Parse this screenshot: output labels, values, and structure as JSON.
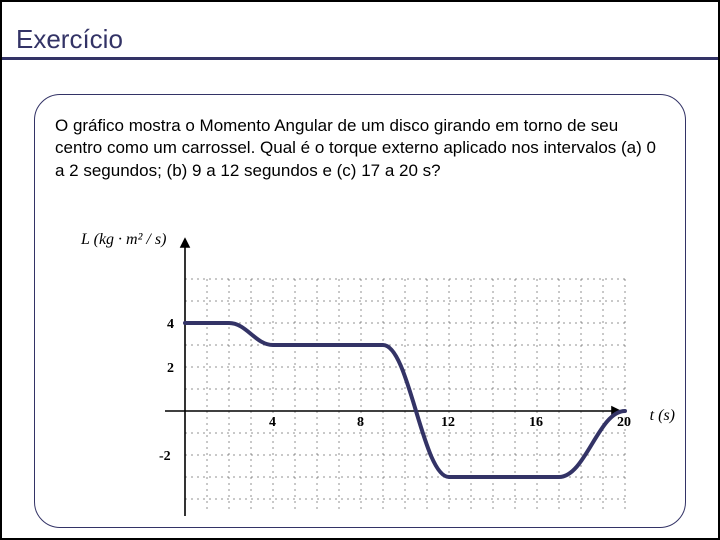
{
  "title": "Exercício",
  "prompt": "O gráfico mostra o Momento Angular de  um disco girando em torno de seu centro como um carrossel. Qual é o torque externo aplicado nos intervalos (a) 0 a 2 segundos; (b) 9 a 12 segundos e (c) 17 a 20 s?",
  "axes": {
    "y_label_html": "L (kg · m² / s)",
    "x_label": "t (s)",
    "x_ticks": [
      "4",
      "8",
      "12",
      "16",
      "20"
    ],
    "y_ticks": [
      "4",
      "2",
      "-2"
    ]
  },
  "chart_data": {
    "type": "line",
    "title": "",
    "xlabel": "t (s)",
    "ylabel": "L (kg·m^2/s)",
    "xlim": [
      0,
      22
    ],
    "ylim": [
      -4,
      6
    ],
    "series": [
      {
        "name": "L(t)",
        "x": [
          0,
          2,
          4,
          6,
          9,
          12,
          15,
          17,
          20
        ],
        "y": [
          4,
          4,
          3,
          3,
          3,
          -3,
          -3,
          -3,
          0
        ]
      }
    ]
  },
  "colors": {
    "frame": "#333366",
    "line": "#333366",
    "accent": "#ffcc33"
  }
}
